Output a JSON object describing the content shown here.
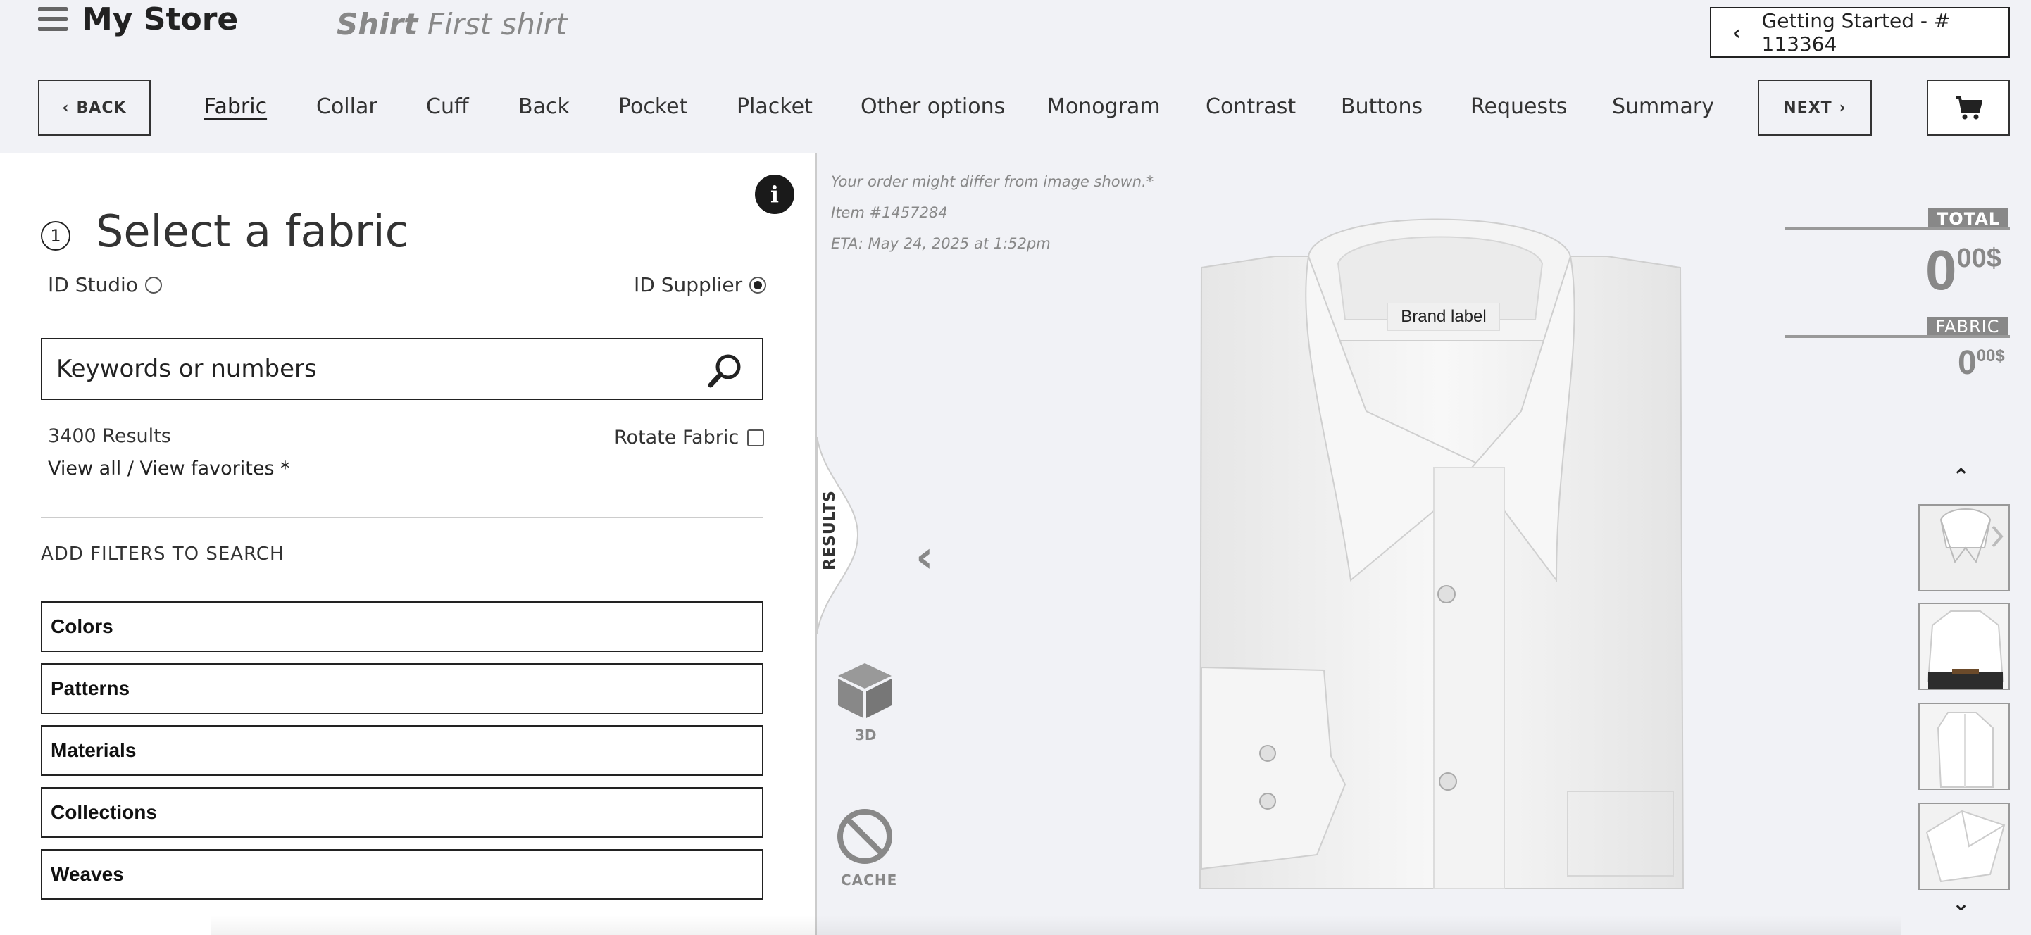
{
  "header": {
    "store_name": "My Store",
    "shirt_title_bold": "Shirt",
    "shirt_title_rest": "First shirt",
    "getting_started": "Getting Started - # 113364"
  },
  "nav": {
    "back_label": "BACK",
    "next_label": "NEXT",
    "tabs": [
      "Fabric",
      "Collar",
      "Cuff",
      "Back",
      "Pocket",
      "Placket",
      "Other options",
      "Monogram",
      "Contrast",
      "Buttons",
      "Requests",
      "Summary"
    ],
    "active_tab": "Fabric"
  },
  "fabric_panel": {
    "step_number": "1",
    "title": "Select a fabric",
    "radio_studio": "ID Studio",
    "radio_supplier": "ID Supplier",
    "selected_radio": "ID Supplier",
    "search_placeholder": "Keywords or numbers",
    "results_count": "3400 Results",
    "rotate_label": "Rotate Fabric",
    "view_links": "View all / View favorites *",
    "filters_heading": "ADD FILTERS TO SEARCH",
    "filters": [
      "Colors",
      "Patterns",
      "Materials",
      "Collections",
      "Weaves"
    ]
  },
  "viewer": {
    "results_tab": "RESULTS",
    "three_d_label": "3D",
    "cache_label": "CACHE",
    "order_note": "Your order might differ from image shown.*",
    "item_number": "Item #1457284",
    "eta": "ETA: May 24, 2025 at 1:52pm",
    "brand_label": "Brand label"
  },
  "pricing": {
    "total_label": "TOTAL",
    "total_value": "0",
    "total_cents": "00$",
    "fabric_label": "FABRIC",
    "fabric_value": "0",
    "fabric_cents": "00$"
  },
  "colors": {
    "accent": "#222222",
    "muted": "#888888",
    "background": "#f1f2f6"
  }
}
